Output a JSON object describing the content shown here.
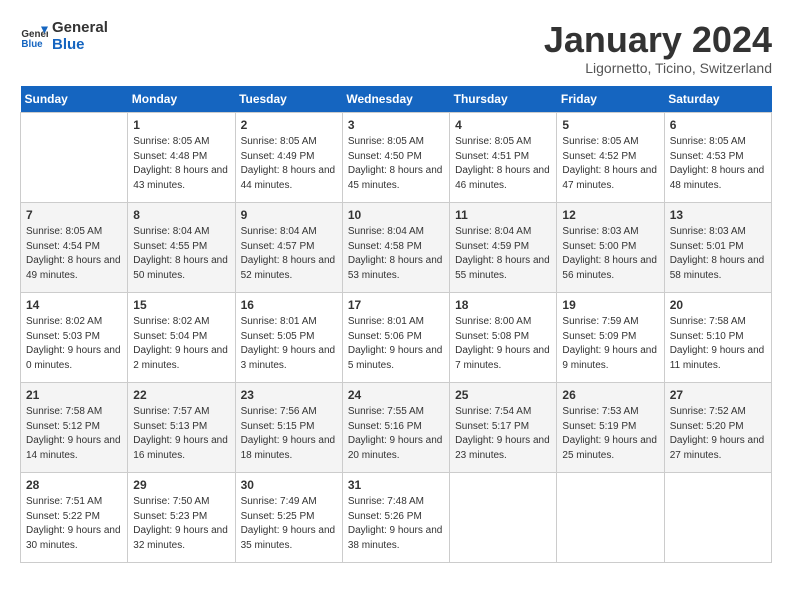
{
  "app": {
    "logo_line1": "General",
    "logo_line2": "Blue"
  },
  "calendar": {
    "title": "January 2024",
    "subtitle": "Ligornetto, Ticino, Switzerland"
  },
  "weekdays": [
    "Sunday",
    "Monday",
    "Tuesday",
    "Wednesday",
    "Thursday",
    "Friday",
    "Saturday"
  ],
  "weeks": [
    [
      {
        "day": "",
        "sunrise": "",
        "sunset": "",
        "daylight": ""
      },
      {
        "day": "1",
        "sunrise": "Sunrise: 8:05 AM",
        "sunset": "Sunset: 4:48 PM",
        "daylight": "Daylight: 8 hours and 43 minutes."
      },
      {
        "day": "2",
        "sunrise": "Sunrise: 8:05 AM",
        "sunset": "Sunset: 4:49 PM",
        "daylight": "Daylight: 8 hours and 44 minutes."
      },
      {
        "day": "3",
        "sunrise": "Sunrise: 8:05 AM",
        "sunset": "Sunset: 4:50 PM",
        "daylight": "Daylight: 8 hours and 45 minutes."
      },
      {
        "day": "4",
        "sunrise": "Sunrise: 8:05 AM",
        "sunset": "Sunset: 4:51 PM",
        "daylight": "Daylight: 8 hours and 46 minutes."
      },
      {
        "day": "5",
        "sunrise": "Sunrise: 8:05 AM",
        "sunset": "Sunset: 4:52 PM",
        "daylight": "Daylight: 8 hours and 47 minutes."
      },
      {
        "day": "6",
        "sunrise": "Sunrise: 8:05 AM",
        "sunset": "Sunset: 4:53 PM",
        "daylight": "Daylight: 8 hours and 48 minutes."
      }
    ],
    [
      {
        "day": "7",
        "sunrise": "Sunrise: 8:05 AM",
        "sunset": "Sunset: 4:54 PM",
        "daylight": "Daylight: 8 hours and 49 minutes."
      },
      {
        "day": "8",
        "sunrise": "Sunrise: 8:04 AM",
        "sunset": "Sunset: 4:55 PM",
        "daylight": "Daylight: 8 hours and 50 minutes."
      },
      {
        "day": "9",
        "sunrise": "Sunrise: 8:04 AM",
        "sunset": "Sunset: 4:57 PM",
        "daylight": "Daylight: 8 hours and 52 minutes."
      },
      {
        "day": "10",
        "sunrise": "Sunrise: 8:04 AM",
        "sunset": "Sunset: 4:58 PM",
        "daylight": "Daylight: 8 hours and 53 minutes."
      },
      {
        "day": "11",
        "sunrise": "Sunrise: 8:04 AM",
        "sunset": "Sunset: 4:59 PM",
        "daylight": "Daylight: 8 hours and 55 minutes."
      },
      {
        "day": "12",
        "sunrise": "Sunrise: 8:03 AM",
        "sunset": "Sunset: 5:00 PM",
        "daylight": "Daylight: 8 hours and 56 minutes."
      },
      {
        "day": "13",
        "sunrise": "Sunrise: 8:03 AM",
        "sunset": "Sunset: 5:01 PM",
        "daylight": "Daylight: 8 hours and 58 minutes."
      }
    ],
    [
      {
        "day": "14",
        "sunrise": "Sunrise: 8:02 AM",
        "sunset": "Sunset: 5:03 PM",
        "daylight": "Daylight: 9 hours and 0 minutes."
      },
      {
        "day": "15",
        "sunrise": "Sunrise: 8:02 AM",
        "sunset": "Sunset: 5:04 PM",
        "daylight": "Daylight: 9 hours and 2 minutes."
      },
      {
        "day": "16",
        "sunrise": "Sunrise: 8:01 AM",
        "sunset": "Sunset: 5:05 PM",
        "daylight": "Daylight: 9 hours and 3 minutes."
      },
      {
        "day": "17",
        "sunrise": "Sunrise: 8:01 AM",
        "sunset": "Sunset: 5:06 PM",
        "daylight": "Daylight: 9 hours and 5 minutes."
      },
      {
        "day": "18",
        "sunrise": "Sunrise: 8:00 AM",
        "sunset": "Sunset: 5:08 PM",
        "daylight": "Daylight: 9 hours and 7 minutes."
      },
      {
        "day": "19",
        "sunrise": "Sunrise: 7:59 AM",
        "sunset": "Sunset: 5:09 PM",
        "daylight": "Daylight: 9 hours and 9 minutes."
      },
      {
        "day": "20",
        "sunrise": "Sunrise: 7:58 AM",
        "sunset": "Sunset: 5:10 PM",
        "daylight": "Daylight: 9 hours and 11 minutes."
      }
    ],
    [
      {
        "day": "21",
        "sunrise": "Sunrise: 7:58 AM",
        "sunset": "Sunset: 5:12 PM",
        "daylight": "Daylight: 9 hours and 14 minutes."
      },
      {
        "day": "22",
        "sunrise": "Sunrise: 7:57 AM",
        "sunset": "Sunset: 5:13 PM",
        "daylight": "Daylight: 9 hours and 16 minutes."
      },
      {
        "day": "23",
        "sunrise": "Sunrise: 7:56 AM",
        "sunset": "Sunset: 5:15 PM",
        "daylight": "Daylight: 9 hours and 18 minutes."
      },
      {
        "day": "24",
        "sunrise": "Sunrise: 7:55 AM",
        "sunset": "Sunset: 5:16 PM",
        "daylight": "Daylight: 9 hours and 20 minutes."
      },
      {
        "day": "25",
        "sunrise": "Sunrise: 7:54 AM",
        "sunset": "Sunset: 5:17 PM",
        "daylight": "Daylight: 9 hours and 23 minutes."
      },
      {
        "day": "26",
        "sunrise": "Sunrise: 7:53 AM",
        "sunset": "Sunset: 5:19 PM",
        "daylight": "Daylight: 9 hours and 25 minutes."
      },
      {
        "day": "27",
        "sunrise": "Sunrise: 7:52 AM",
        "sunset": "Sunset: 5:20 PM",
        "daylight": "Daylight: 9 hours and 27 minutes."
      }
    ],
    [
      {
        "day": "28",
        "sunrise": "Sunrise: 7:51 AM",
        "sunset": "Sunset: 5:22 PM",
        "daylight": "Daylight: 9 hours and 30 minutes."
      },
      {
        "day": "29",
        "sunrise": "Sunrise: 7:50 AM",
        "sunset": "Sunset: 5:23 PM",
        "daylight": "Daylight: 9 hours and 32 minutes."
      },
      {
        "day": "30",
        "sunrise": "Sunrise: 7:49 AM",
        "sunset": "Sunset: 5:25 PM",
        "daylight": "Daylight: 9 hours and 35 minutes."
      },
      {
        "day": "31",
        "sunrise": "Sunrise: 7:48 AM",
        "sunset": "Sunset: 5:26 PM",
        "daylight": "Daylight: 9 hours and 38 minutes."
      },
      {
        "day": "",
        "sunrise": "",
        "sunset": "",
        "daylight": ""
      },
      {
        "day": "",
        "sunrise": "",
        "sunset": "",
        "daylight": ""
      },
      {
        "day": "",
        "sunrise": "",
        "sunset": "",
        "daylight": ""
      }
    ]
  ]
}
